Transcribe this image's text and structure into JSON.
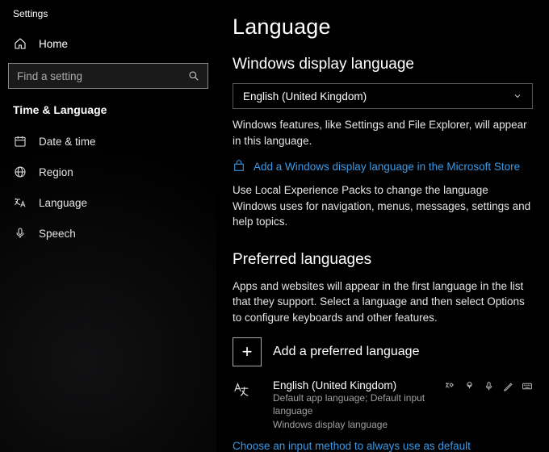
{
  "window_title": "Settings",
  "sidebar": {
    "home_label": "Home",
    "search_placeholder": "Find a setting",
    "section_head": "Time & Language",
    "items": [
      {
        "label": "Date & time"
      },
      {
        "label": "Region"
      },
      {
        "label": "Language"
      },
      {
        "label": "Speech"
      }
    ]
  },
  "main": {
    "page_title": "Language",
    "display_section": {
      "heading": "Windows display language",
      "selected": "English (United Kingdom)",
      "description": "Windows features, like Settings and File Explorer, will appear in this language.",
      "store_link": "Add a Windows display language in the Microsoft Store",
      "local_packs_text": "Use Local Experience Packs to change the language Windows uses for navigation, menus, messages, settings and help topics."
    },
    "preferred_section": {
      "heading": "Preferred languages",
      "description": "Apps and websites will appear in the first language in the list that they support. Select a language and then select Options to configure keyboards and other features.",
      "add_label": "Add a preferred language",
      "languages": [
        {
          "name": "English (United Kingdom)",
          "sub1": "Default app language; Default input language",
          "sub2": "Windows display language"
        }
      ],
      "input_method_link": "Choose an input method to always use as default"
    }
  }
}
